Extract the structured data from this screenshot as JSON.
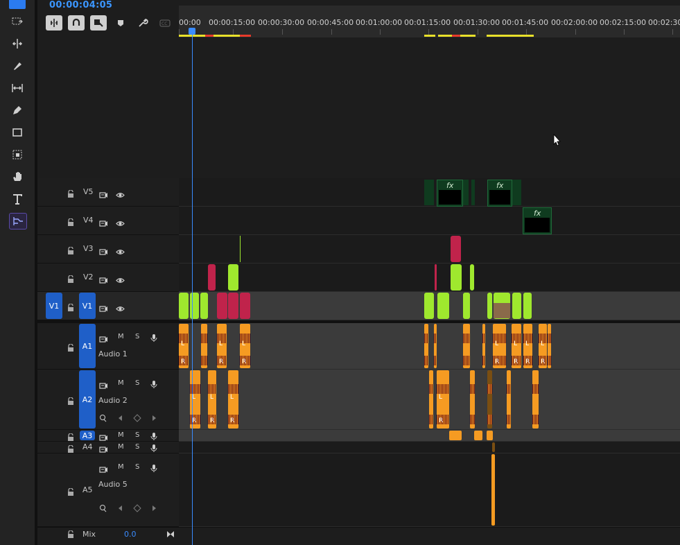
{
  "timecode": "00:00:04:05",
  "ruler": {
    "ticks": [
      "00:00",
      "00:00:15:00",
      "00:00:30:00",
      "00:00:45:00",
      "00:01:00:00",
      "00:01:15:00",
      "00:01:30:00",
      "00:01:45:00",
      "00:02:00:00",
      "00:02:15:00",
      "00:02:30:"
    ]
  },
  "video_tracks": [
    {
      "id": "V5",
      "label": "V5"
    },
    {
      "id": "V4",
      "label": "V4"
    },
    {
      "id": "V3",
      "label": "V3"
    },
    {
      "id": "V2",
      "label": "V2"
    },
    {
      "id": "V1",
      "label": "V1",
      "source": "V1"
    }
  ],
  "audio_tracks": [
    {
      "id": "A1",
      "label": "A1",
      "name": "Audio 1",
      "m": "M",
      "s": "S"
    },
    {
      "id": "A2",
      "label": "A2",
      "name": "Audio 2",
      "m": "M",
      "s": "S"
    },
    {
      "id": "A3",
      "label": "A3",
      "m": "M",
      "s": "S"
    },
    {
      "id": "A4",
      "label": "A4",
      "m": "M",
      "s": "S"
    },
    {
      "id": "A5",
      "label": "A5",
      "name": "Audio 5",
      "m": "M",
      "s": "S"
    }
  ],
  "fx_label": "fx",
  "channel_left": "L",
  "channel_right": "R",
  "mix": {
    "label": "Mix",
    "value": "0.0"
  }
}
